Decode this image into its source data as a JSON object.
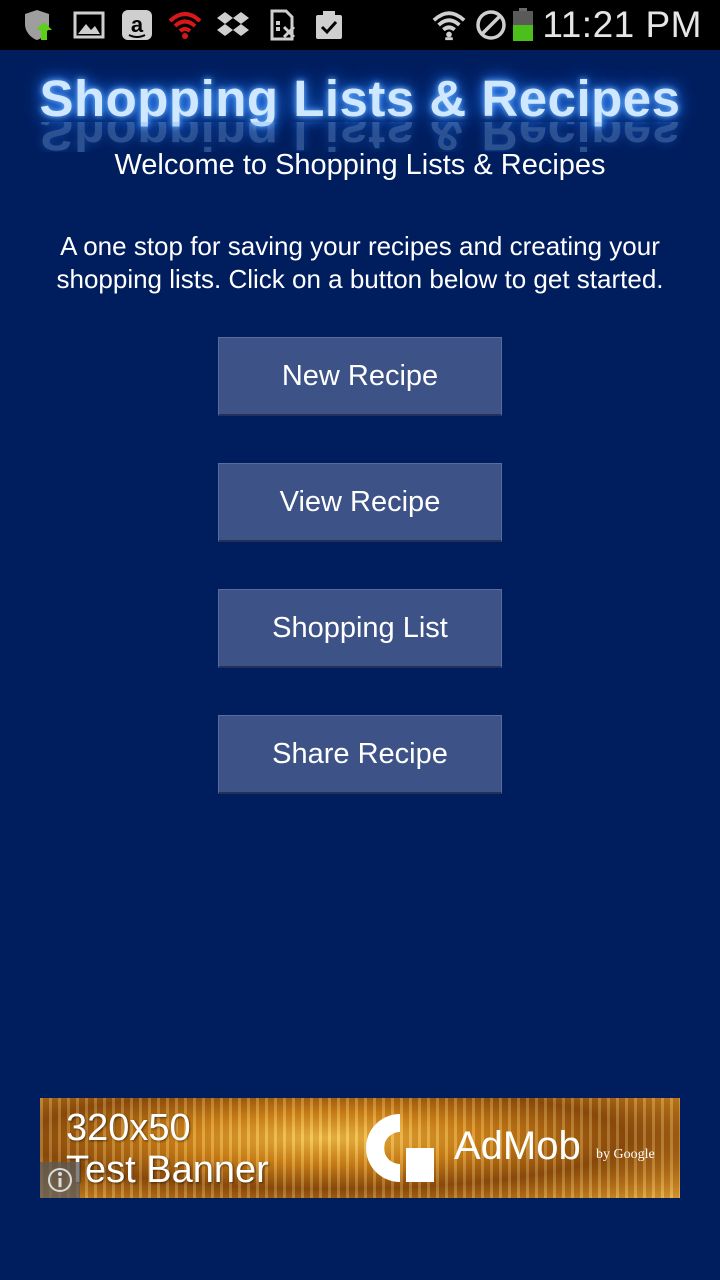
{
  "status_bar": {
    "time": "11:21 PM",
    "icons": [
      "shield-update-icon",
      "image-icon",
      "amazon-icon",
      "wifi-alert-icon",
      "dropbox-icon",
      "sim-card-icon",
      "clipboard-check-icon",
      "wifi-icon",
      "no-signal-icon",
      "battery-icon"
    ],
    "colors": {
      "background": "#000000",
      "battery_fill": "#4cbf1a",
      "alert_red": "#d81818"
    }
  },
  "app": {
    "logo_text": "Shopping Lists & Recipes",
    "welcome": "Welcome to Shopping Lists & Recipes",
    "description": "A one stop for saving your recipes and creating your shopping lists. Click on a button below to get started.",
    "buttons": [
      {
        "label": "New Recipe"
      },
      {
        "label": "View Recipe"
      },
      {
        "label": "Shopping List"
      },
      {
        "label": "Share Recipe"
      }
    ],
    "colors": {
      "background": "#001e5e",
      "button": "#3d5286",
      "text": "#ffffff"
    }
  },
  "ad_banner": {
    "size_text": "320x50",
    "test_text": "Test Banner",
    "brand": "AdMob",
    "by": "by Google",
    "info_icon": "info-icon"
  }
}
